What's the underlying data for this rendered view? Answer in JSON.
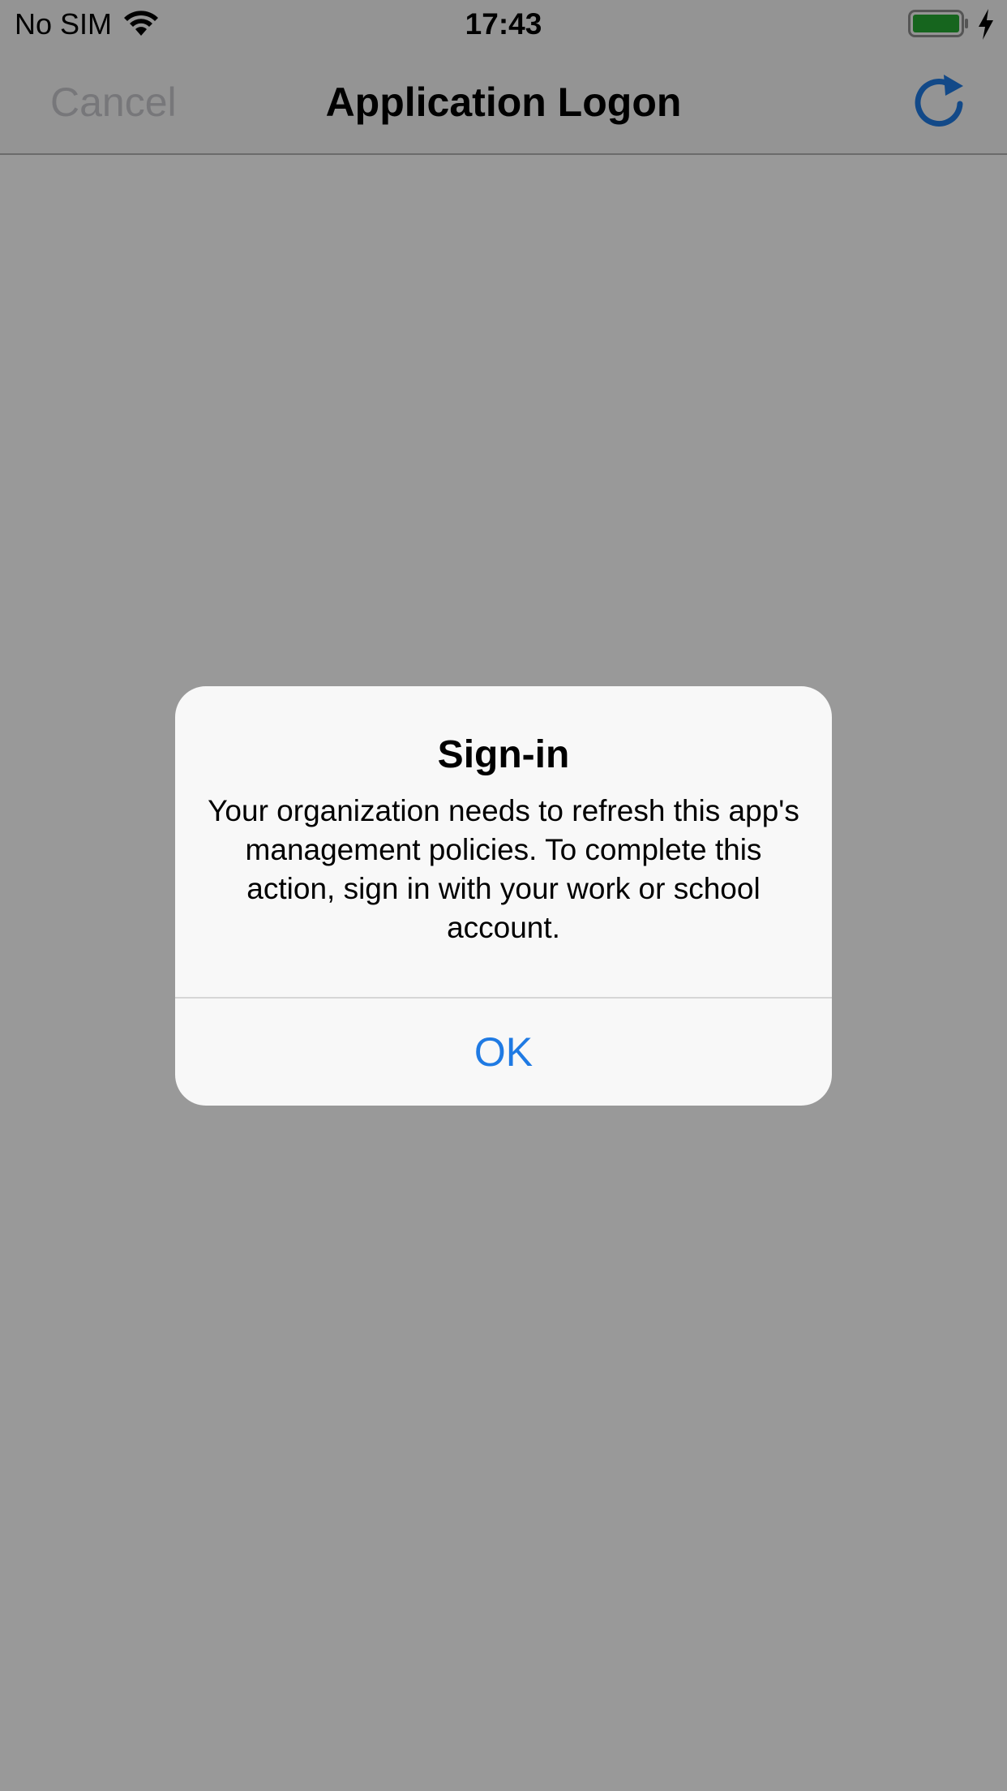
{
  "status_bar": {
    "carrier": "No SIM",
    "time": "17:43",
    "wifi_icon": "wifi-icon",
    "battery_icon": "battery-icon",
    "charging_icon": "charging-bolt-icon",
    "battery_level": 1.0,
    "battery_color": "#26a833"
  },
  "nav_bar": {
    "cancel_label": "Cancel",
    "title": "Application Logon",
    "refresh_icon": "refresh-icon",
    "accent_color": "#1f7ae3",
    "cancel_color": "#c7c7cc"
  },
  "alert": {
    "title": "Sign-in",
    "message": "Your organization needs to refresh this app's management policies. To complete this action, sign in with your work or school account.",
    "ok_label": "OK"
  }
}
